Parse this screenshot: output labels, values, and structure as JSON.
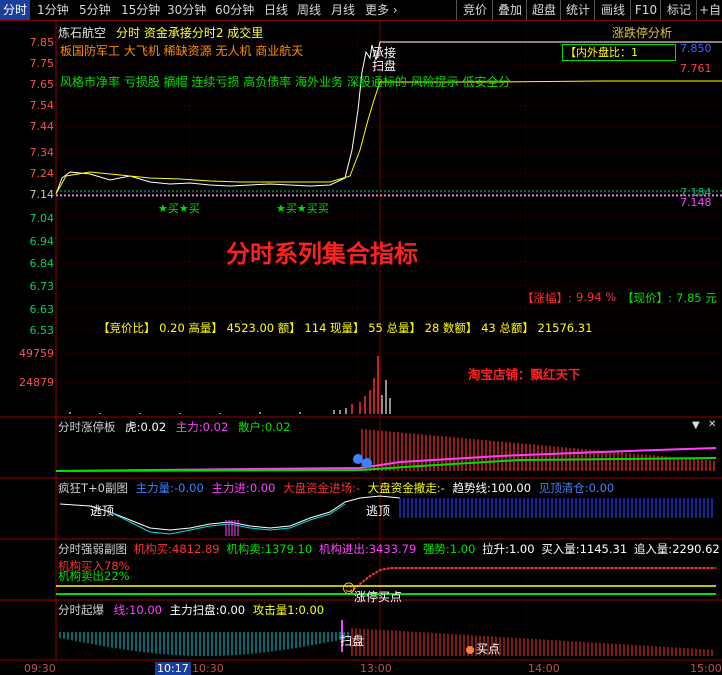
{
  "topbar": {
    "tabs": [
      "分时",
      "1分钟",
      "5分钟",
      "15分钟",
      "30分钟",
      "60分钟",
      "日线",
      "周线",
      "月线",
      "更多 ›"
    ],
    "right_tabs": [
      "竞价",
      "叠加",
      "超盘",
      "统计",
      "画线",
      "F10",
      "标记",
      "+自"
    ]
  },
  "header": {
    "stock": "炼石航空",
    "indicator": "分时 资金承接分时2 成交里",
    "limit_btn": "涨跌停分析"
  },
  "concepts": {
    "line1": "板国防军工 大飞机 稀缺资源 无人机 商业航天",
    "line2": "风格市净率 亏损股 摘帽 连续亏损 高负债率 海外业务 深股通标的 风险提示 低安全分"
  },
  "overlay": {
    "inout_ratio": "【内外盘比：1",
    "title": "分时系列集合指标",
    "shop": "淘宝店铺：飘红天下",
    "zhangfu_label": "【涨幅】:",
    "zhangfu_value": "9.94 %",
    "xianjia_label": "【现价】:",
    "xianjia_value": "7.85 元",
    "auction_row": "【竞价比】 0.20 高量】 4523.00 额】 114 现量】 55 总量】 28 数额】 43 总额】 21576.31",
    "buy_marks": "★买★买",
    "buy_marks2": "★买★买买",
    "price_tags": [
      "7.850",
      "7.761",
      "7.184",
      "7.148"
    ],
    "jieban": "扫盘",
    "chengjiao": "承接"
  },
  "price_axis": [
    "7.85",
    "7.75",
    "7.65",
    "7.54",
    "7.44",
    "7.34",
    "7.24",
    "7.14",
    "7.04",
    "6.94",
    "6.84",
    "6.73",
    "6.63",
    "6.53"
  ],
  "volume_axis": [
    "49759",
    "24879"
  ],
  "panels": {
    "p1": {
      "title": "分时涨停板",
      "k1": "虎:",
      "v1": "0.02",
      "k2": "主力:",
      "v2": "0.02",
      "k3": "散户:",
      "v3": "0.02"
    },
    "p2": {
      "title": "疯狂T+0副图",
      "k1": "主力量:",
      "v1": "-0.00",
      "k2": "主力进:",
      "v2": "0.00",
      "k3": "大盘资金进场:",
      "v3": "-",
      "k4": "大盘资金撤走:",
      "v4": "-",
      "k5": "趋势线:",
      "v5": "100.00",
      "k6": "见顶清仓:",
      "v6": "0.00",
      "mark1": "逃顶",
      "mark2": "逃顶"
    },
    "p3": {
      "title": "分时强弱副图",
      "k1": "机构买:",
      "v1": "4812.89",
      "k2": "机构卖:",
      "v2": "1379.10",
      "k3": "机构进出:",
      "v3": "3433.79",
      "k4": "强势:",
      "v4": "1.00",
      "k5": "拉升:",
      "v5": "1.00",
      "k6": "买入量:",
      "v6": "1145.31",
      "k7": "追入量:",
      "v7": "2290.62",
      "buy_pct": "机构买入78%",
      "sell_pct": "机构卖出22%",
      "mark": "涨停买点"
    },
    "p4": {
      "title": "分时起爆",
      "k1": "线:",
      "v1": "10.00",
      "k2": "主力扫盘:",
      "v2": "0.00",
      "k3": "攻击量1:",
      "v3": "0.00",
      "mark1": "扫盘",
      "mark2": "买点"
    }
  },
  "time_axis": [
    "09:30",
    "10:17",
    "10:30",
    "13:00",
    "14:00",
    "15:00"
  ],
  "colors": {
    "up": "#ff3030",
    "down": "#00e0e0",
    "yellow": "#ffff00",
    "green": "#00ff00",
    "magenta": "#ff00ff",
    "label": "#ff5050"
  }
}
